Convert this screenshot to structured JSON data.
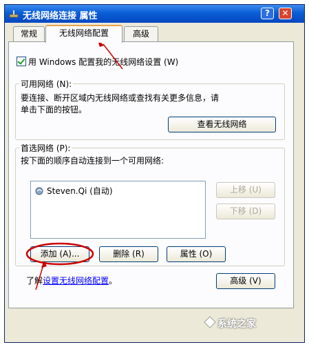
{
  "window": {
    "title": "无线网络连接 属性",
    "help_label": "?",
    "close_label": "✕"
  },
  "tabs": [
    {
      "label": "常规"
    },
    {
      "label": "无线网络配置"
    },
    {
      "label": "高级"
    }
  ],
  "checkbox": {
    "label": "用 Windows 配置我的无线网络设置 (W)",
    "checked": true
  },
  "available": {
    "label": "可用网络 (N):",
    "description_line1": "要连接、断开区域内无线网络或查找有关更多信息，请",
    "description_line2": "单击下面的按钮。",
    "view_button": "查看无线网络"
  },
  "preferred": {
    "label": "首选网络 (P):",
    "description": "按下面的顺序自动连接到一个可用网络:",
    "networks": [
      {
        "name": "Steven.Qi (自动)"
      }
    ],
    "move_up": "上移 (U)",
    "move_down": "下移 (D)",
    "add": "添加 (A)...",
    "remove": "删除 (R)",
    "properties": "属性 (O)"
  },
  "footer": {
    "learn_prefix": "了解",
    "learn_link": "设置无线网络配置",
    "learn_suffix": "。",
    "advanced": "高级 (V)"
  },
  "watermark": "系统之家",
  "colors": {
    "titlebar": "#0a5ed6",
    "annotation": "#cc0000",
    "dialog_bg": "#ece9d8"
  },
  "icons": [
    "network-icon",
    "wireless-network-icon",
    "help-icon",
    "close-icon"
  ]
}
